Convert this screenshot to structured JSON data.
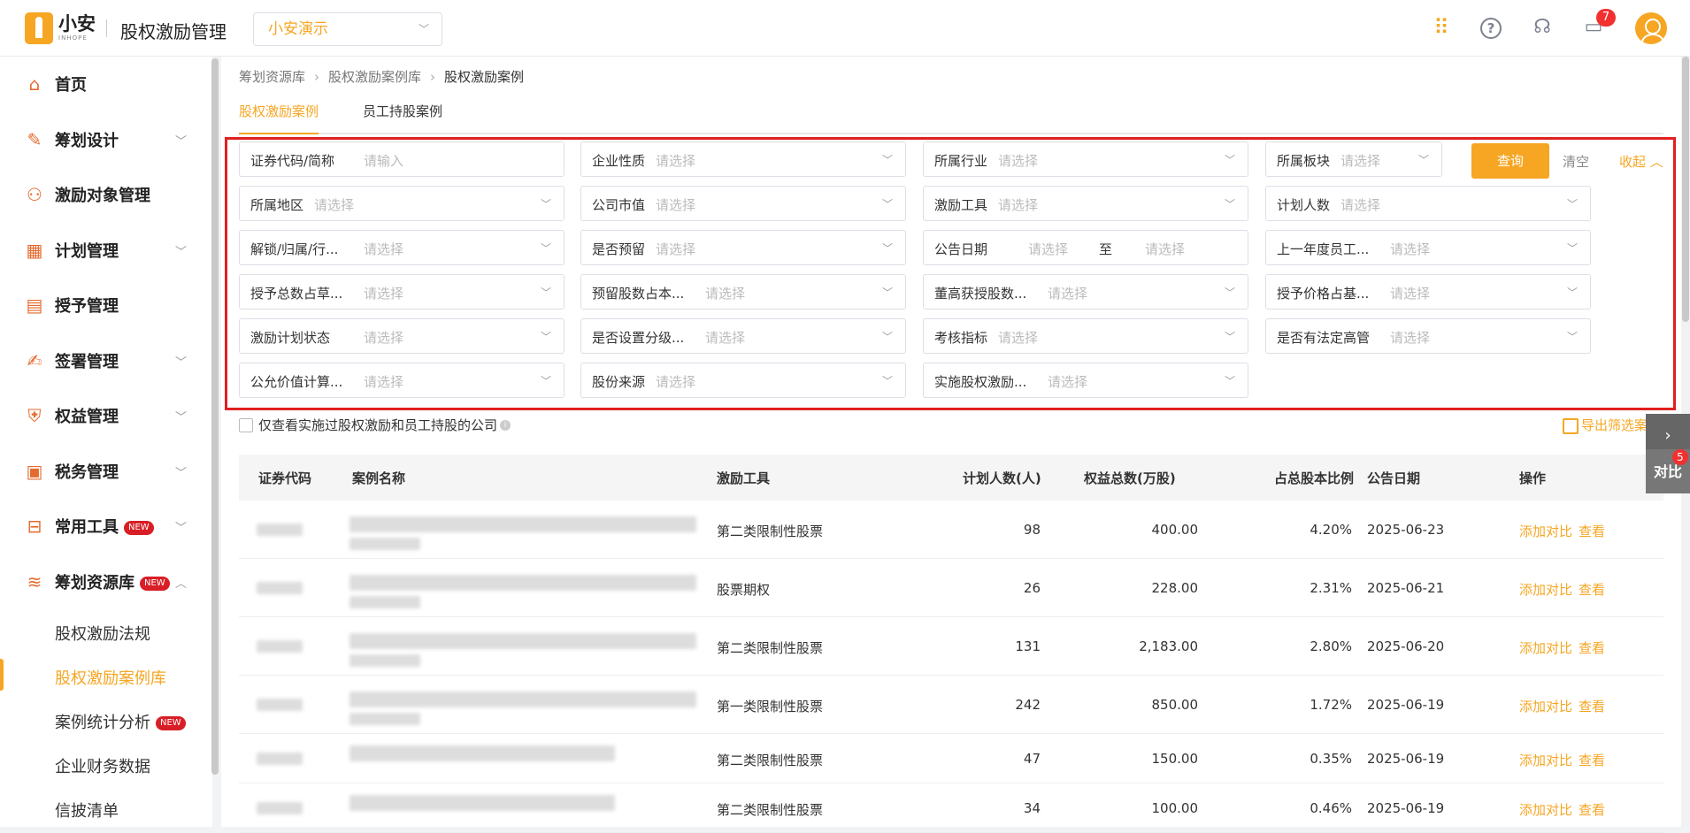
{
  "header": {
    "logo_name": "小安",
    "logo_sub": "INHOPE",
    "app_title": "股权激励管理",
    "org_select": "小安演示",
    "notification_count": "7",
    "icons": [
      "apps-grid-icon",
      "help-icon",
      "customer-service-icon",
      "message-icon",
      "user-avatar"
    ]
  },
  "sidebar": {
    "items": [
      {
        "label": "首页",
        "icon": "home-icon"
      },
      {
        "label": "筹划设计",
        "icon": "edit-icon"
      },
      {
        "label": "激励对象管理",
        "icon": "users-icon"
      },
      {
        "label": "计划管理",
        "icon": "grid-icon"
      },
      {
        "label": "授予管理",
        "icon": "book-icon"
      },
      {
        "label": "签署管理",
        "icon": "sign-icon"
      },
      {
        "label": "权益管理",
        "icon": "shield-icon"
      },
      {
        "label": "税务管理",
        "icon": "tax-icon"
      },
      {
        "label": "常用工具",
        "icon": "toolbox-icon",
        "badge": "NEW"
      },
      {
        "label": "筹划资源库",
        "icon": "layers-icon",
        "badge": "NEW"
      }
    ],
    "sub_items": [
      {
        "label": "股权激励法规"
      },
      {
        "label": "股权激励案例库"
      },
      {
        "label": "案例统计分析",
        "badge": "NEW"
      },
      {
        "label": "企业财务数据"
      },
      {
        "label": "信披清单"
      }
    ]
  },
  "breadcrumb": [
    "筹划资源库",
    "股权激励案例库",
    "股权激励案例"
  ],
  "tabs": [
    "股权激励案例",
    "员工持股案例"
  ],
  "filters": [
    {
      "label": "证券代码/简称",
      "placeholder": "请输入"
    },
    {
      "label": "企业性质",
      "placeholder": "请选择"
    },
    {
      "label": "所属行业",
      "placeholder": "请选择"
    },
    {
      "label": "所属板块",
      "placeholder": "请选择"
    },
    {
      "label": "所属地区",
      "placeholder": "请选择"
    },
    {
      "label": "公司市值",
      "placeholder": "请选择"
    },
    {
      "label": "激励工具",
      "placeholder": "请选择"
    },
    {
      "label": "计划人数",
      "placeholder": "请选择"
    },
    {
      "label": "解锁/归属/行...",
      "placeholder": "请选择"
    },
    {
      "label": "是否预留",
      "placeholder": "请选择"
    },
    {
      "label": "公告日期",
      "placeholder": "请选择",
      "to": "至",
      "placeholder2": "请选择"
    },
    {
      "label": "上一年度员工...",
      "placeholder": "请选择"
    },
    {
      "label": "授予总数占草...",
      "placeholder": "请选择"
    },
    {
      "label": "预留股数占本...",
      "placeholder": "请选择"
    },
    {
      "label": "董高获授股数...",
      "placeholder": "请选择"
    },
    {
      "label": "授予价格占基...",
      "placeholder": "请选择"
    },
    {
      "label": "激励计划状态",
      "placeholder": "请选择"
    },
    {
      "label": "是否设置分级...",
      "placeholder": "请选择"
    },
    {
      "label": "考核指标",
      "placeholder": "请选择"
    },
    {
      "label": "是否有法定高管",
      "placeholder": "请选择"
    },
    {
      "label": "公允价值计算...",
      "placeholder": "请选择"
    },
    {
      "label": "股份来源",
      "placeholder": "请选择"
    },
    {
      "label": "实施股权激励...",
      "placeholder": "请选择"
    }
  ],
  "actions": {
    "query": "查询",
    "clear": "清空",
    "collapse": "收起"
  },
  "checkbox_label": "仅查看实施过股权激励和员工持股的公司",
  "export_label": "导出筛选案例",
  "table": {
    "headers": [
      "证券代码",
      "案例名称",
      "激励工具",
      "计划人数(人)",
      "权益总数(万股)",
      "占总股本比例",
      "公告日期",
      "操作"
    ],
    "rows": [
      {
        "tool": "第二类限制性股票",
        "people": "98",
        "total": "400.00",
        "ratio": "4.20%",
        "date": "2025-06-23"
      },
      {
        "tool": "股票期权",
        "people": "26",
        "total": "228.00",
        "ratio": "2.31%",
        "date": "2025-06-21"
      },
      {
        "tool": "第二类限制性股票",
        "people": "131",
        "total": "2,183.00",
        "ratio": "2.80%",
        "date": "2025-06-20"
      },
      {
        "tool": "第一类限制性股票",
        "people": "242",
        "total": "850.00",
        "ratio": "1.72%",
        "date": "2025-06-19"
      },
      {
        "tool": "第二类限制性股票",
        "people": "47",
        "total": "150.00",
        "ratio": "0.35%",
        "date": "2025-06-19"
      },
      {
        "tool": "第二类限制性股票",
        "people": "34",
        "total": "100.00",
        "ratio": "0.46%",
        "date": "2025-06-19"
      }
    ],
    "op_add": "添加对比",
    "op_view": "查看"
  },
  "float": {
    "compare": "对比",
    "compare_count": "5"
  }
}
